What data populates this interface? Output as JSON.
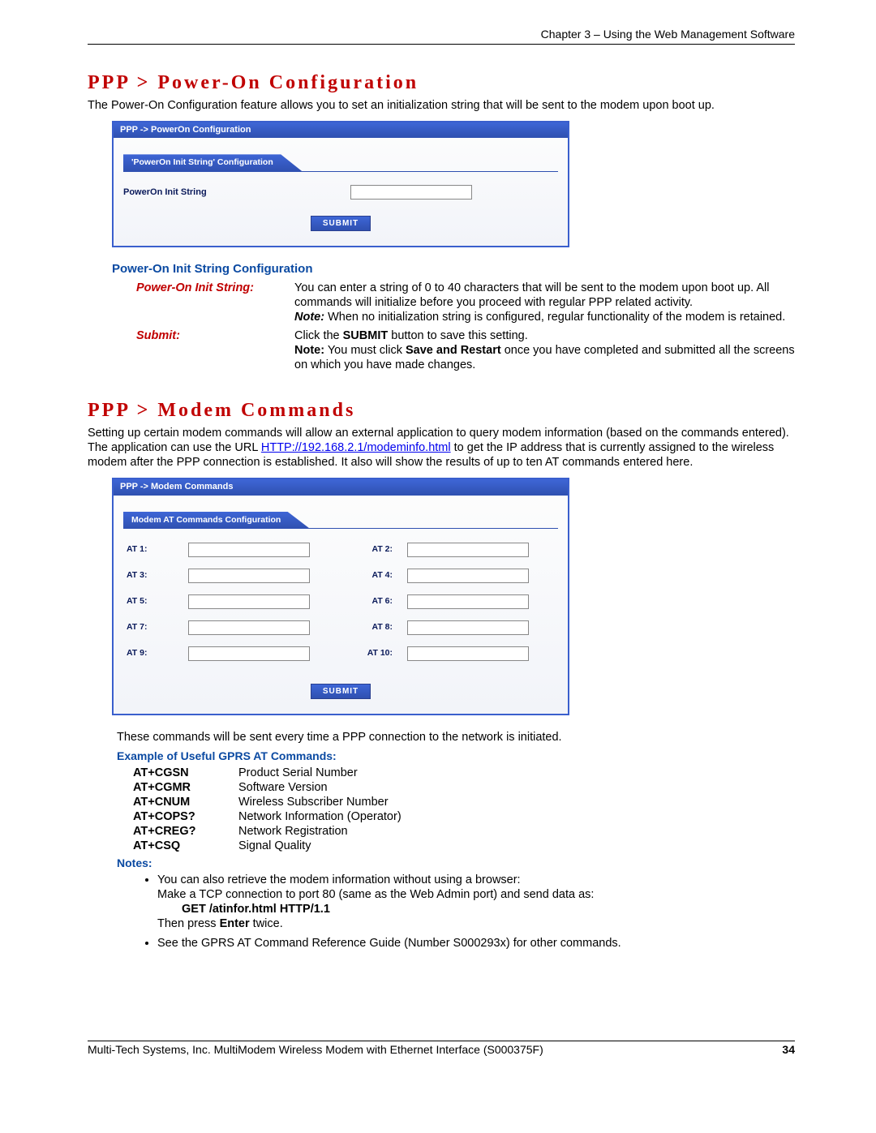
{
  "header": {
    "chapter": "Chapter 3 – Using the Web Management Software"
  },
  "section1": {
    "title": "PPP > Power-On Configuration",
    "intro": "The Power-On Configuration feature allows you to set an initialization string that will be sent to the modem upon boot up.",
    "panel": {
      "header": "PPP  ->  PowerOn Configuration",
      "tab": "'PowerOn Init String' Configuration",
      "field_label": "PowerOn Init String",
      "submit": "SUBMIT"
    },
    "subhead": "Power-On Init String Configuration",
    "defs": {
      "row1_term": "Power-On Init String:",
      "row1_a": "You can enter a string of 0 to 40 characters that will be sent to the modem upon boot up. All commands will initialize before you proceed with regular PPP related activity.",
      "row1_note_label": "Note:",
      "row1_note": " When no initialization string is configured, regular functionality of the modem is retained.",
      "row2_term": "Submit:",
      "row2_a": "Click the ",
      "row2_submit": "SUBMIT",
      "row2_b": " button to save this setting.",
      "row2_note_label": "Note:",
      "row2_c": " You must click ",
      "row2_save": "Save and Restart",
      "row2_d": " once you have completed and submitted all the screens on which you have made changes."
    }
  },
  "section2": {
    "title": "PPP > Modem Commands",
    "intro_a": "Setting up certain modem commands will allow an external application to query modem information (based on the commands entered). The application can use the URL ",
    "intro_link": "HTTP://192.168.2.1/modeminfo.html",
    "intro_b": " to get the IP address that is currently assigned to the wireless modem after the PPP connection is established. It also will show the results of up to ten AT commands entered here.",
    "panel": {
      "header": "PPP  ->  Modem Commands",
      "tab": "Modem AT Commands Configuration",
      "labels": [
        "AT 1:",
        "AT 2:",
        "AT 3:",
        "AT 4:",
        "AT 5:",
        "AT 6:",
        "AT 7:",
        "AT 8:",
        "AT 9:",
        "AT 10:"
      ],
      "submit": "SUBMIT"
    },
    "sent_line": "These commands will be sent every time a PPP connection to the network is initiated.",
    "example_head": "Example of Useful GPRS AT Commands:",
    "cmds": [
      {
        "k": "AT+CGSN",
        "v": "Product Serial Number"
      },
      {
        "k": "AT+CGMR",
        "v": "Software Version"
      },
      {
        "k": "AT+CNUM",
        "v": "Wireless Subscriber Number"
      },
      {
        "k": "AT+COPS?",
        "v": "Network Information (Operator)"
      },
      {
        "k": "AT+CREG?",
        "v": "Network Registration"
      },
      {
        "k": "AT+CSQ",
        "v": "Signal Quality"
      }
    ],
    "notes_head": "Notes:",
    "note1_a": "You can also retrieve the modem information without using a browser:",
    "note1_b": "Make a TCP connection to port 80 (same as the Web Admin port) and send data as:",
    "note1_get": "GET /atinfor.html HTTP/1.1",
    "note1_c": "Then press ",
    "note1_enter": "Enter",
    "note1_d": " twice.",
    "note2": "See the GPRS AT Command Reference Guide (Number S000293x) for other commands."
  },
  "footer": {
    "left": "Multi-Tech Systems, Inc. MultiModem Wireless Modem with Ethernet Interface (S000375F)",
    "right": "34"
  }
}
